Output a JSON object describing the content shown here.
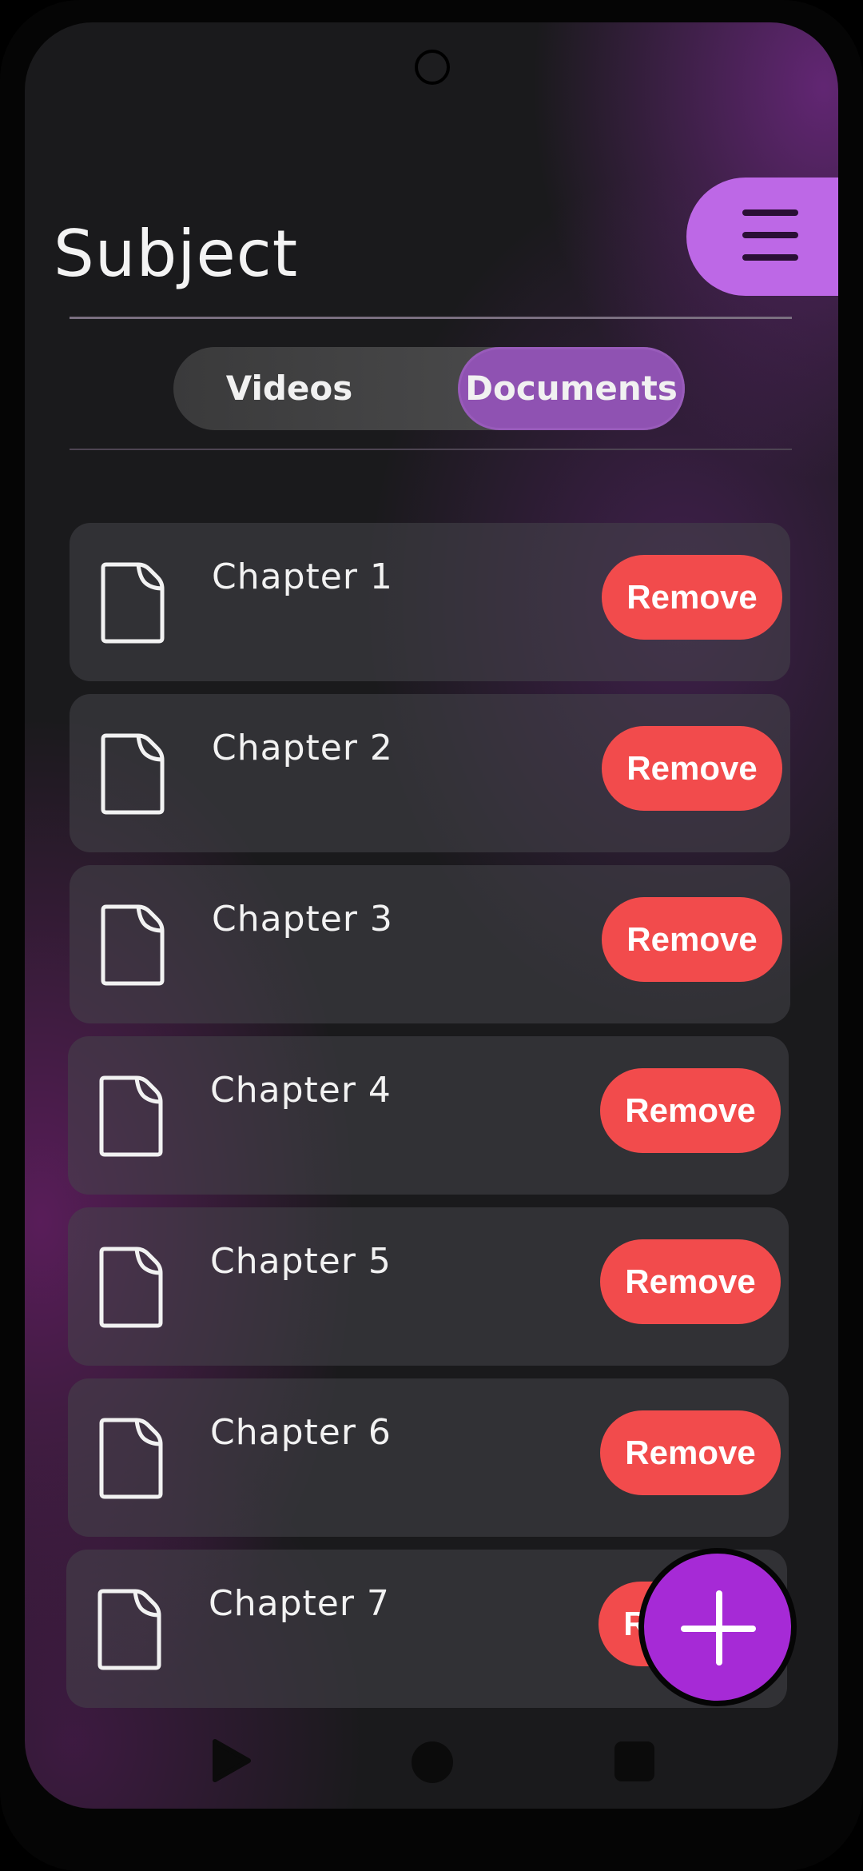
{
  "header": {
    "title": "Subject",
    "menu_icon": "hamburger-menu-icon"
  },
  "tabs": {
    "items": [
      {
        "label": "Videos",
        "selected": false
      },
      {
        "label": "Documents",
        "selected": true
      }
    ]
  },
  "documents": {
    "icon": "document-icon",
    "items": [
      {
        "label": "Chapter 1",
        "action": "Remove"
      },
      {
        "label": "Chapter 2",
        "action": "Remove"
      },
      {
        "label": "Chapter 3",
        "action": "Remove"
      },
      {
        "label": "Chapter 4",
        "action": "Remove"
      },
      {
        "label": "Chapter 5",
        "action": "Remove"
      },
      {
        "label": "Chapter 6",
        "action": "Remove"
      },
      {
        "label": "Chapter 7",
        "action": "Remove"
      }
    ]
  },
  "fab": {
    "icon": "plus-icon"
  },
  "navigation": {
    "back_icon": "back-triangle-icon",
    "home_icon": "home-circle-icon",
    "recents_icon": "recents-square-icon"
  },
  "colors": {
    "accent": "#bd68e6",
    "tab_selected": "#8f52b2",
    "remove": "#f24b4c",
    "fab": "#a62ad6",
    "background": "#1a1a1c"
  }
}
